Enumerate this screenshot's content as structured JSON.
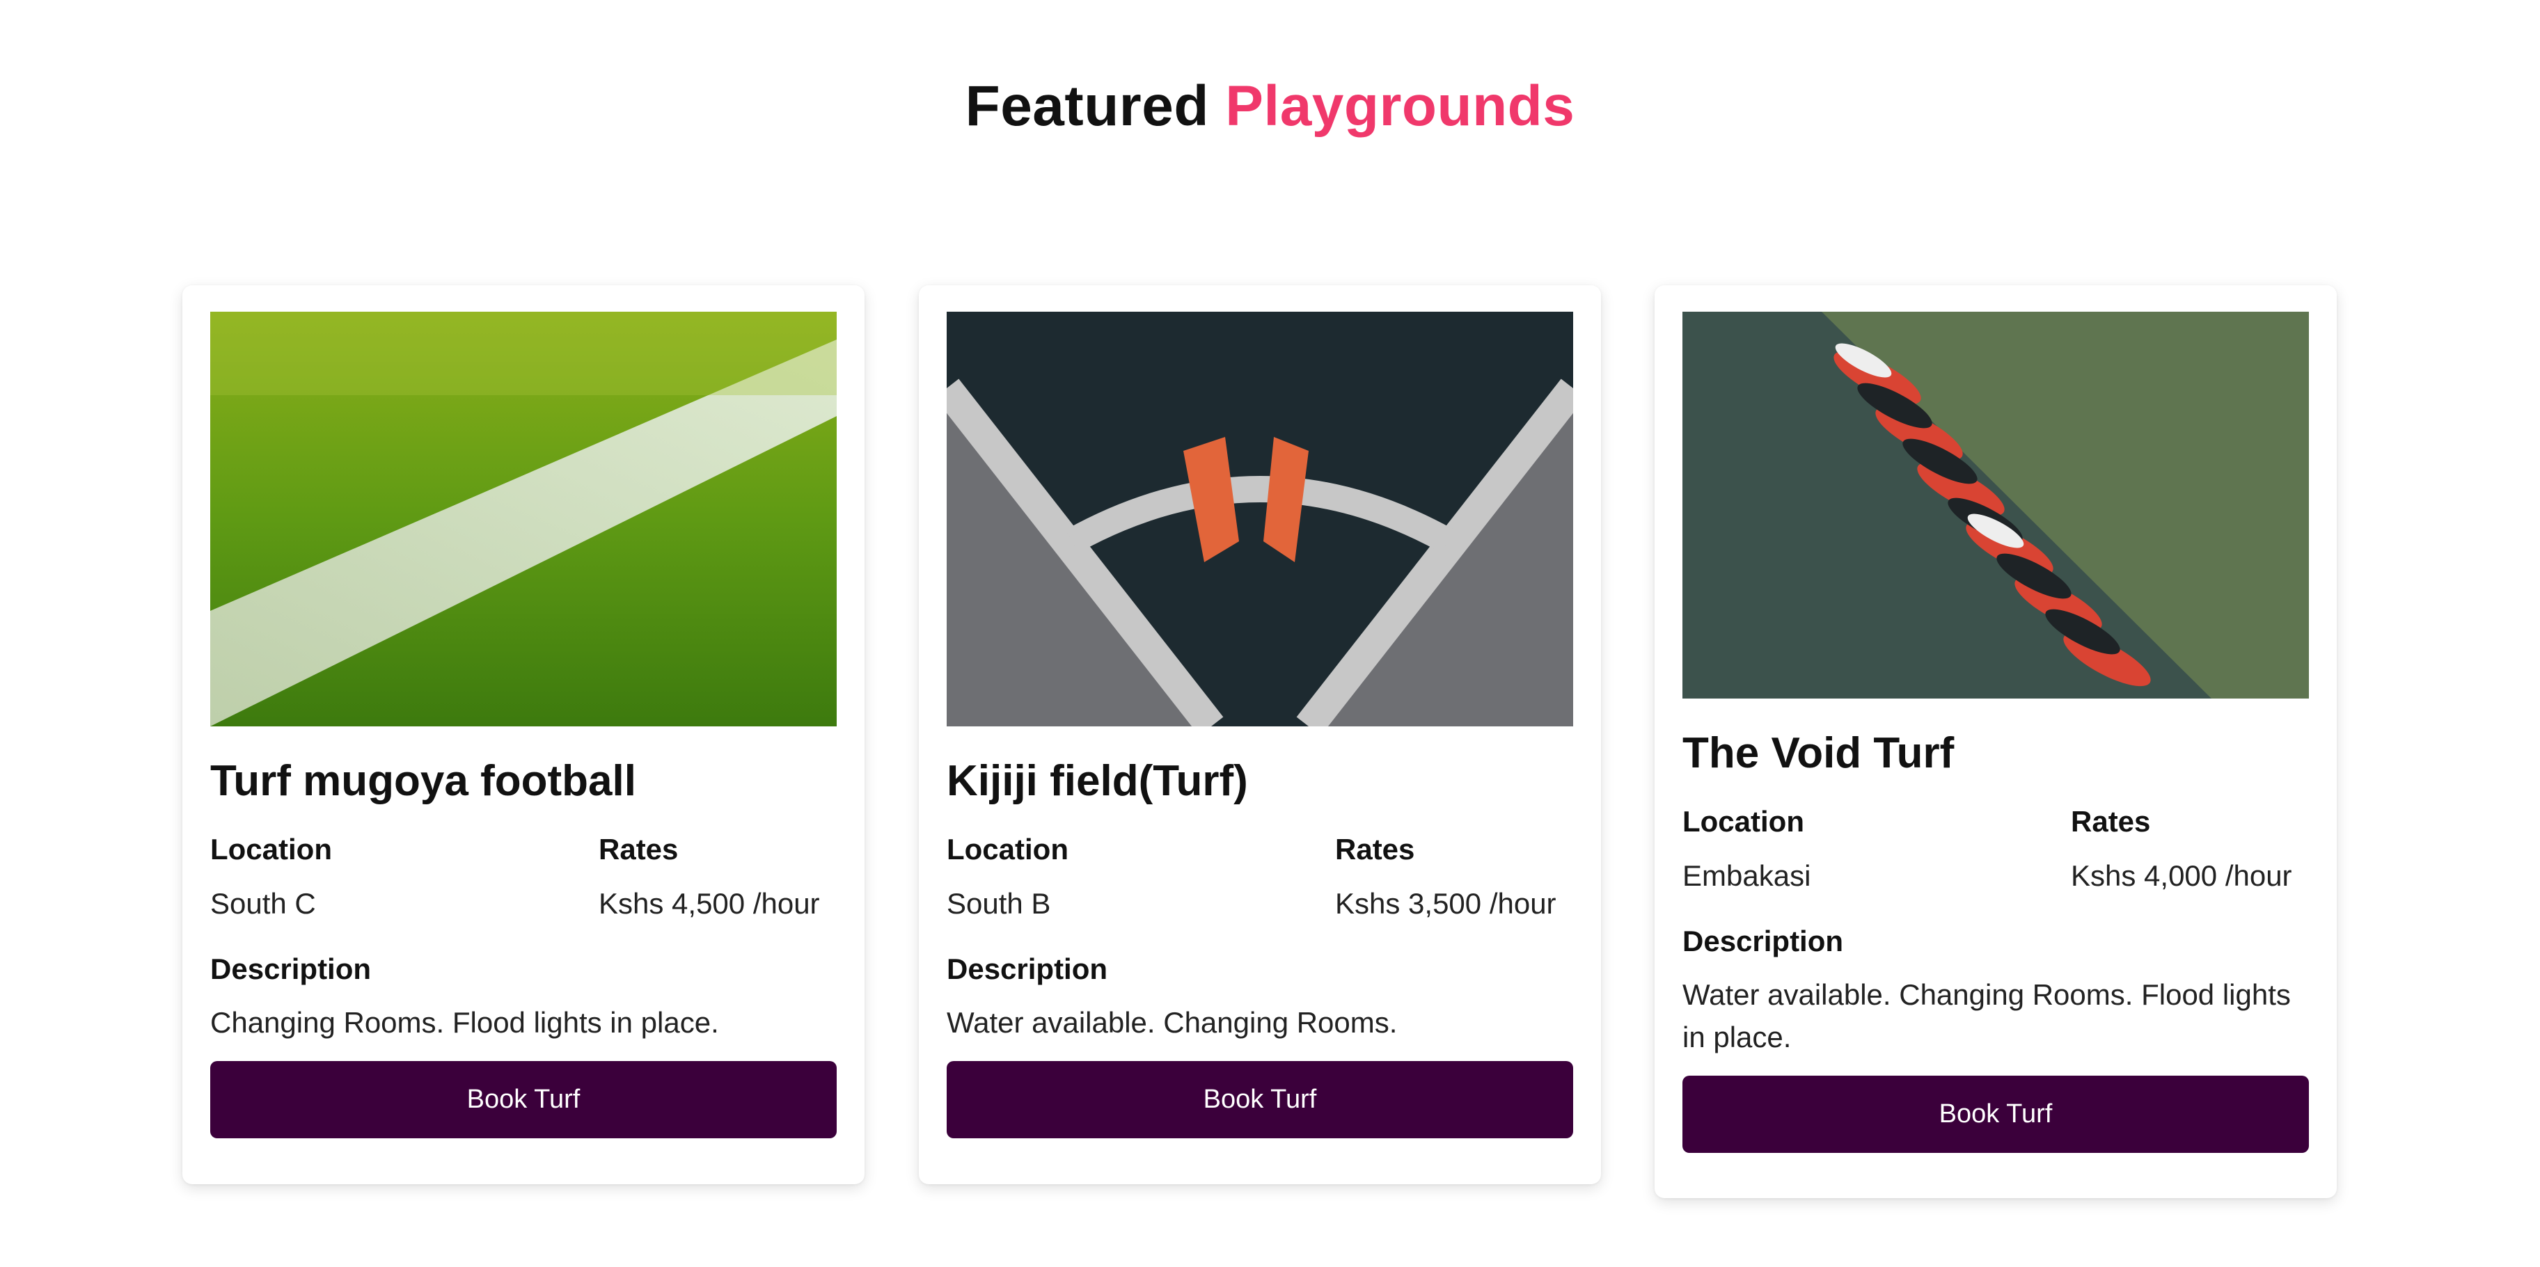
{
  "header": {
    "title_part1": "Featured",
    "title_part2": "Playgrounds",
    "accent_color": "#f0386b"
  },
  "labels": {
    "location": "Location",
    "rates": "Rates",
    "description": "Description",
    "book_button": "Book Turf"
  },
  "cards": [
    {
      "title": "Turf mugoya football",
      "location": "South C",
      "rate": "Kshs 4,500 /hour",
      "description": "Changing Rooms. Flood lights in place.",
      "image": "grass-field-line-photo"
    },
    {
      "title": "Kijiji field(Turf)",
      "location": "South B",
      "rate": "Kshs 3,500 /hour",
      "description": "Water available. Changing Rooms.",
      "image": "football-boots-on-corner-photo"
    },
    {
      "title": "The Void Turf",
      "location": "Embakasi",
      "rate": "Kshs 4,000 /hour",
      "description": "Water available. Changing Rooms. Flood lights in place.",
      "image": "row-of-football-boots-photo"
    }
  ],
  "colors": {
    "button_bg": "#3b003b",
    "button_text": "#ffffff"
  }
}
